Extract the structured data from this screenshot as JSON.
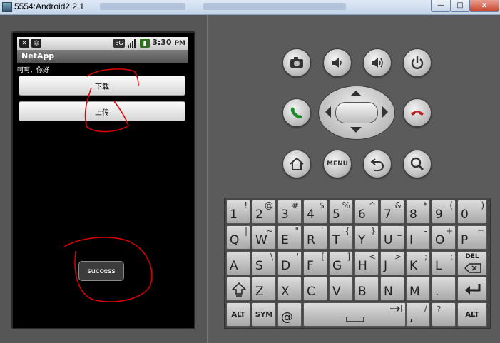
{
  "window": {
    "title": "5554:Android2.2.1",
    "minimize": "—",
    "maximize": "□",
    "close": "x"
  },
  "phone": {
    "clock": "3:30",
    "clock_suffix": "PM",
    "signal_type": "3G",
    "app_title": "NetApp",
    "greeting": "呵呵，你好",
    "download_button": "下载",
    "upload_button": "上传",
    "toast": "success"
  },
  "controls": {
    "menu_label": "MENU"
  },
  "keyboard": {
    "row1": [
      {
        "main": "1",
        "alt": "!"
      },
      {
        "main": "2",
        "alt": "@"
      },
      {
        "main": "3",
        "alt": "#"
      },
      {
        "main": "4",
        "alt": "$"
      },
      {
        "main": "5",
        "alt": "%"
      },
      {
        "main": "6",
        "alt": "^"
      },
      {
        "main": "7",
        "alt": "&"
      },
      {
        "main": "8",
        "alt": "*"
      },
      {
        "main": "9",
        "alt": "("
      },
      {
        "main": "0",
        "alt": ")"
      }
    ],
    "row2": [
      {
        "main": "Q",
        "alt": "|"
      },
      {
        "main": "W",
        "alt": "~"
      },
      {
        "main": "E",
        "alt": "\""
      },
      {
        "main": "R",
        "alt": "`"
      },
      {
        "main": "T",
        "alt": "{"
      },
      {
        "main": "Y",
        "alt": "}"
      },
      {
        "main": "U",
        "alt": "_"
      },
      {
        "main": "I",
        "alt": "-"
      },
      {
        "main": "O",
        "alt": "+"
      },
      {
        "main": "P",
        "alt": "="
      }
    ],
    "row3": [
      {
        "main": "A",
        "alt": ""
      },
      {
        "main": "S",
        "alt": "\\"
      },
      {
        "main": "D",
        "alt": "'"
      },
      {
        "main": "F",
        "alt": "["
      },
      {
        "main": "G",
        "alt": "]"
      },
      {
        "main": "H",
        "alt": "<"
      },
      {
        "main": "J",
        "alt": ">"
      },
      {
        "main": "K",
        "alt": ";"
      },
      {
        "main": "L",
        "alt": ":"
      }
    ],
    "del_label": "DEL",
    "row4": [
      {
        "main": "Z",
        "alt": ""
      },
      {
        "main": "X",
        "alt": ""
      },
      {
        "main": "C",
        "alt": ""
      },
      {
        "main": "V",
        "alt": ""
      },
      {
        "main": "B",
        "alt": ""
      },
      {
        "main": "N",
        "alt": ""
      },
      {
        "main": "M",
        "alt": ""
      },
      {
        "main": ".",
        "alt": ""
      }
    ],
    "alt_label": "ALT",
    "sym_label": "SYM",
    "at_key": "@",
    "slash_key": {
      "main": ",",
      "alt": "/"
    },
    "question_key": "?"
  }
}
